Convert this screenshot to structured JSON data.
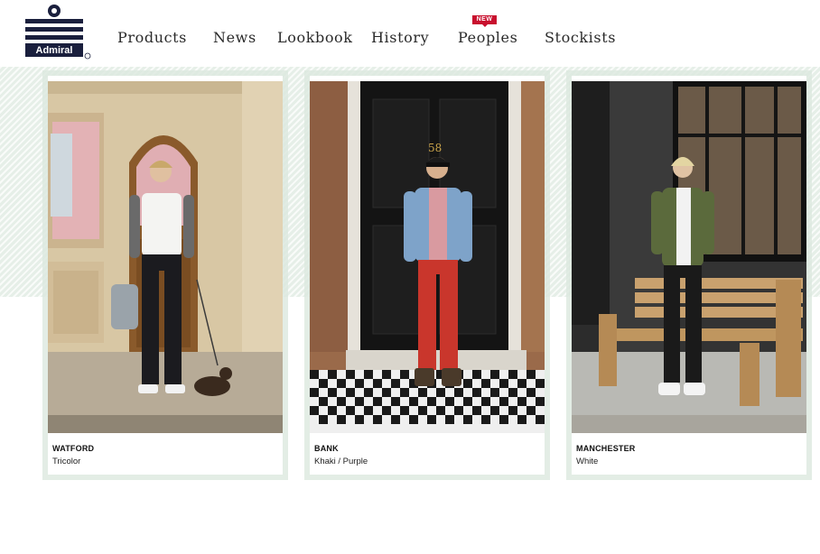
{
  "brand": {
    "logo_text": "Admiral"
  },
  "nav": {
    "items": [
      "Products",
      "News",
      "Lookbook",
      "History",
      "Peoples",
      "Stockists"
    ],
    "new_badge": "NEW"
  },
  "cards": [
    {
      "name": "WATFORD",
      "color": "Tricolor"
    },
    {
      "name": "BANK",
      "color": "Khaki / Purple"
    },
    {
      "name": "MANCHESTER",
      "color": "White"
    }
  ],
  "photo_text": {
    "door_number": "58"
  }
}
